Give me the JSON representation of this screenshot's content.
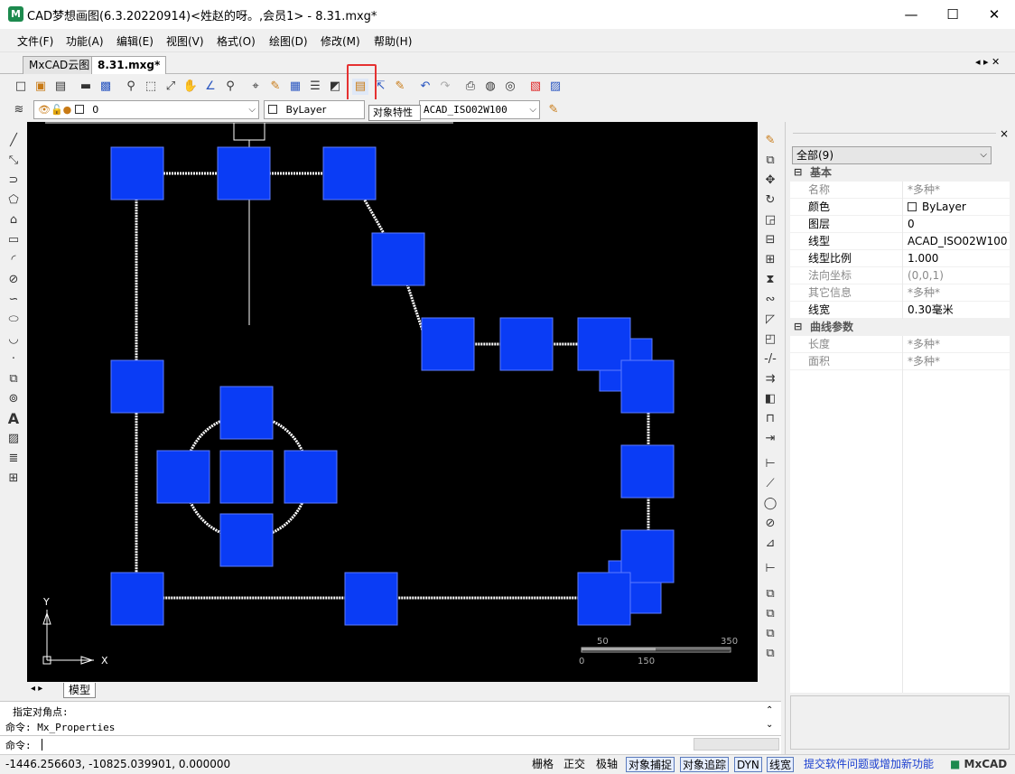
{
  "window": {
    "title": "CAD梦想画图(6.3.20220914)<姓赵的呀。,会员1> - 8.31.mxg*",
    "icon_letter": "M",
    "controls": {
      "minimize": "—",
      "maximize": "☐",
      "close": "✕"
    }
  },
  "menu": [
    "文件(F)",
    "功能(A)",
    "编辑(E)",
    "视图(V)",
    "格式(O)",
    "绘图(D)",
    "修改(M)",
    "帮助(H)"
  ],
  "doc_tabs": [
    {
      "label": "MxCAD云图",
      "active": false
    },
    {
      "label": "8.31.mxg*",
      "active": true
    }
  ],
  "tab_nav": "◂ ▸ ✕",
  "toolbar2": {
    "layer_value": "0",
    "color_value": "ByLayer",
    "linetype_value": "ACAD_ISO02W100"
  },
  "tooltip": "对象特性",
  "canvas": {
    "scale_labels": {
      "top_left": "50",
      "top_right": "350",
      "bottom_left": "0",
      "bottom_mid": "150"
    },
    "axis_y": "Y",
    "axis_x": "X"
  },
  "properties": {
    "close": "×",
    "filter": "全部(9)",
    "sections": [
      {
        "title": "基本",
        "rows": [
          {
            "key": "名称",
            "value": "*多种*",
            "greyed": true
          },
          {
            "key": "颜色",
            "value": "ByLayer",
            "greyed": false,
            "swatch": true
          },
          {
            "key": "图层",
            "value": "0",
            "greyed": false
          },
          {
            "key": "线型",
            "value": "ACAD_ISO02W100",
            "greyed": false
          },
          {
            "key": "线型比例",
            "value": "1.000",
            "greyed": false
          },
          {
            "key": "法向坐标",
            "value": "(0,0,1)",
            "greyed": true
          },
          {
            "key": "其它信息",
            "value": "*多种*",
            "greyed": true
          },
          {
            "key": "线宽",
            "value": "0.30毫米",
            "greyed": false
          }
        ]
      },
      {
        "title": "曲线参数",
        "rows": [
          {
            "key": "长度",
            "value": "*多种*",
            "greyed": true
          },
          {
            "key": "面积",
            "value": "*多种*",
            "greyed": true
          }
        ]
      }
    ]
  },
  "model_tab": "模型",
  "command": {
    "line1": "指定对角点:",
    "line2": "命令: Mx_Properties",
    "prompt": "命令:"
  },
  "status": {
    "coords": "-1446.256603,  -10825.039901,  0.000000",
    "toggles": [
      {
        "label": "栅格",
        "on": false
      },
      {
        "label": "正交",
        "on": false
      },
      {
        "label": "极轴",
        "on": false
      },
      {
        "label": "对象捕捉",
        "on": true
      },
      {
        "label": "对象追踪",
        "on": true
      },
      {
        "label": "DYN",
        "on": true
      },
      {
        "label": "线宽",
        "on": true
      }
    ],
    "feedback_link": "提交软件问题或增加新功能",
    "brand": "MxCAD",
    "link_color": "#1a3fd0"
  },
  "colors": {
    "block_fill": "#0a3cf5",
    "highlight": "#e53131"
  }
}
